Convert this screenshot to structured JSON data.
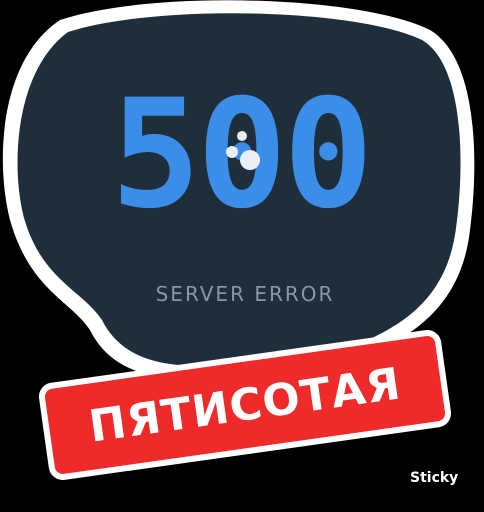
{
  "error": {
    "code_part1": "5",
    "code_part2": "0",
    "code_part3": "0",
    "subtitle": "SERVER ERROR"
  },
  "sticker": {
    "banner_text": "ПЯТИСОТАЯ",
    "watermark": "Sticky"
  },
  "colors": {
    "blob_fill": "#1f2e3b",
    "digit_color": "#3b8de8",
    "subtitle_color": "#8a96a0",
    "banner_color": "#ef2a2a",
    "outline": "#ffffff"
  }
}
